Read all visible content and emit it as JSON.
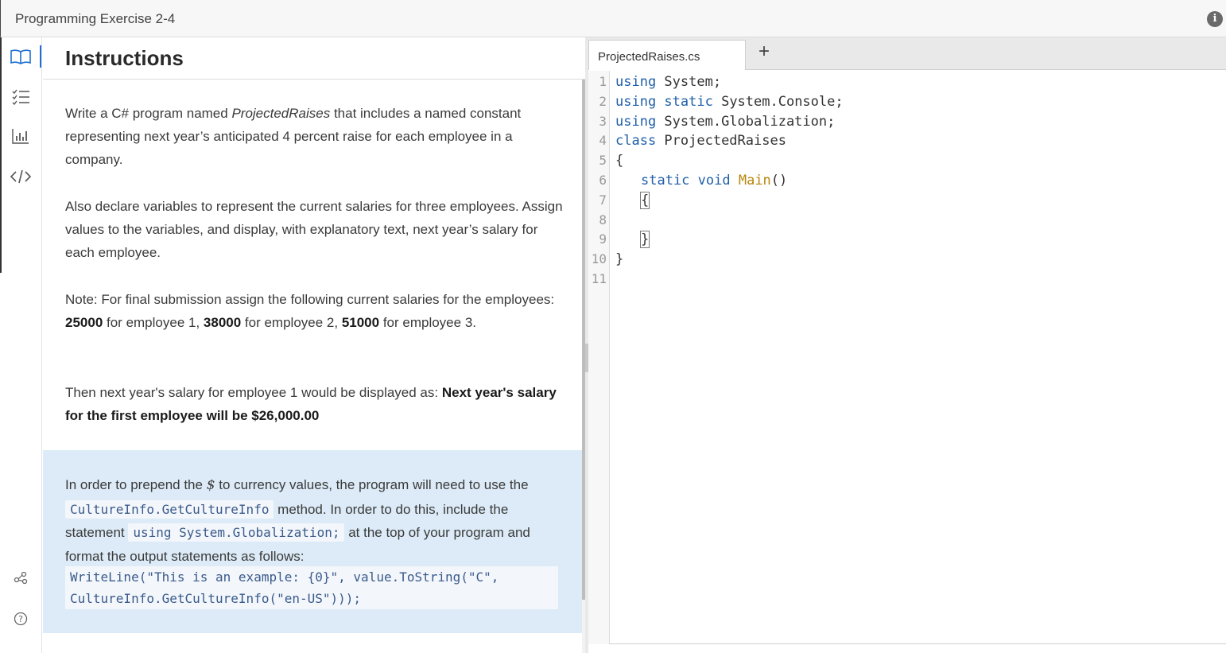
{
  "window": {
    "title": "Programming Exercise 2-4",
    "info_icon": "info-icon"
  },
  "rail": {
    "items": [
      {
        "name": "book-icon",
        "active": true
      },
      {
        "name": "checklist-icon",
        "active": false
      },
      {
        "name": "bar-chart-icon",
        "active": false
      },
      {
        "name": "code-icon",
        "active": false
      },
      {
        "name": "share-icon",
        "active": false
      },
      {
        "name": "help-icon",
        "active": false
      }
    ]
  },
  "instructions": {
    "heading": "Instructions",
    "p1": {
      "a": "Write a C# program named ",
      "name": "ProjectedRaises",
      "b": " that includes a named constant representing next year’s anticipated 4 percent raise for each employee in a company."
    },
    "p2": "Also declare variables to represent the current salaries for three employees. Assign values to the variables, and display, with explanatory text, next year’s salary for each employee.",
    "p3": {
      "a": "Note: For final submission assign the following current salaries for the employees: ",
      "v1": "25000",
      "b": " for employee 1, ",
      "v2": "38000",
      "c": " for employee 2, ",
      "v3": "51000",
      "d": " for employee 3."
    },
    "p4": {
      "a": "Then next year's salary for employee 1 would be displayed as: ",
      "bold": "Next year's salary for the first employee will be $26,000.00"
    },
    "note": {
      "a": "In order to prepend the ",
      "symbol": "$",
      "b": " to currency values, the program will need to use the ",
      "code1": "CultureInfo.GetCultureInfo",
      "c": " method. In order to do this, include the statement ",
      "code2": "using System.Globalization;",
      "d": " at the top of your program and format the output statements as follows:",
      "code_line1": "WriteLine(\"This is an example: {0}\", value.ToString(\"C\",",
      "code_line2": "CultureInfo.GetCultureInfo(\"en-US\")));"
    }
  },
  "editor": {
    "file_tab": "ProjectedRaises.cs",
    "add_tab": "+",
    "line_numbers": [
      "1",
      "2",
      "3",
      "4",
      "5",
      "6",
      "7",
      "8",
      "9",
      "10",
      "11"
    ],
    "lines": {
      "l1": {
        "kw": "using",
        "rest": " System;"
      },
      "l2": {
        "kw": "using",
        "kw2": " static",
        "rest": " System.Console;"
      },
      "l3": {
        "kw": "using",
        "rest": " System.Globalization;"
      },
      "l4": {
        "kw": "class",
        "rest": " ProjectedRaises"
      },
      "l5": "{",
      "l6": {
        "kw": "static",
        "kw2": " void",
        "fn": " Main",
        "rest": "()"
      },
      "l7": "{",
      "l9": "}",
      "l10": "}"
    }
  }
}
